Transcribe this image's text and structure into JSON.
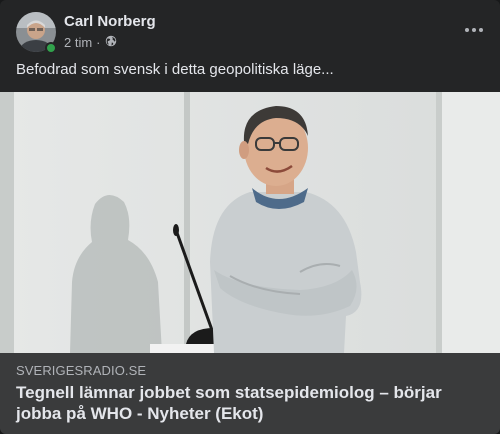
{
  "post": {
    "author": "Carl Norberg",
    "time": "2 tim",
    "separator": "·",
    "privacy_icon": "globe-icon",
    "text": "Befodrad som svensk i detta geopolitiska läge...",
    "more_icon": "more-horizontal-icon"
  },
  "link": {
    "domain": "SVERIGESRADIO.SE",
    "headline": "Tegnell lämnar jobbet som statsepidemiolog – börjar jobba på WHO - Nyheter (Ekot)"
  },
  "colors": {
    "card": "#242526",
    "link_box": "#3a3b3c",
    "primary_text": "#e4e6eb",
    "secondary_text": "#b0b3b8",
    "online": "#31a24c"
  }
}
